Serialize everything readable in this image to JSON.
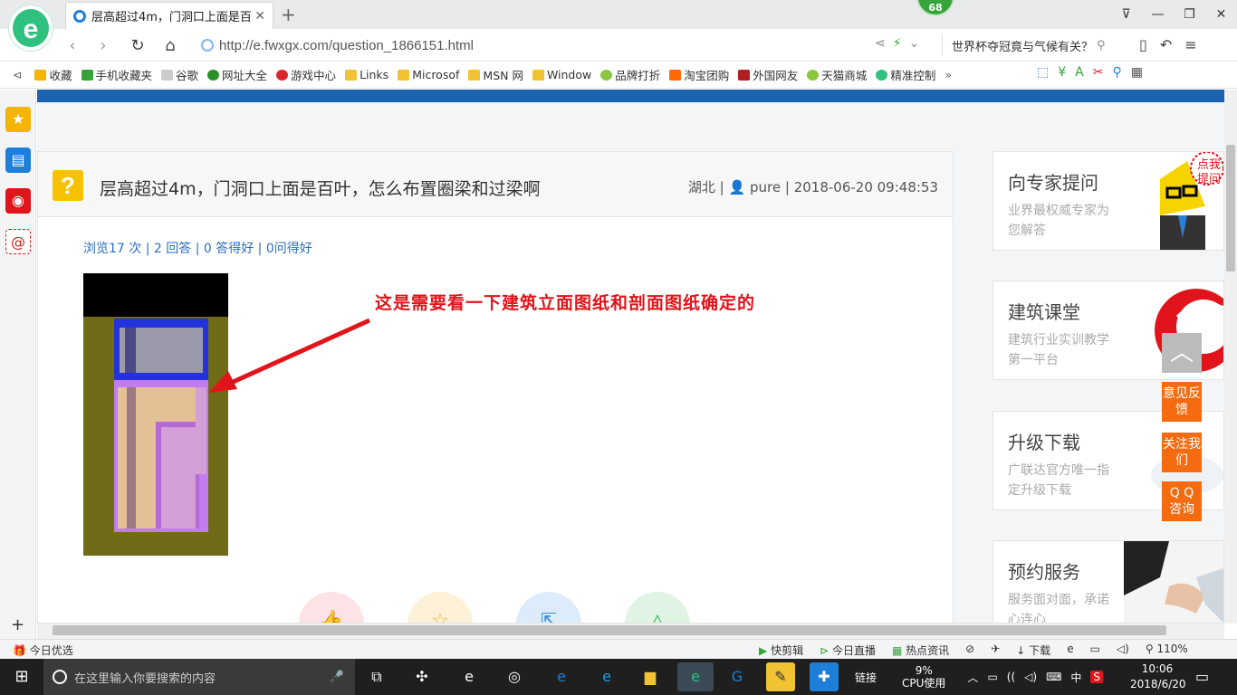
{
  "browser": {
    "tab_title": "层高超过4m，门洞口上面是百叶",
    "tab_close": "✕",
    "new_tab": "+",
    "badge_count": "68",
    "url": "http://e.fwxgx.com/question_1866151.html",
    "search_text": "世界杯夺冠竟与气候有关？",
    "window_controls": [
      "⊽",
      "—",
      "❐",
      "✕"
    ],
    "bookmarks": [
      {
        "label": "收藏",
        "color": "#f5b400"
      },
      {
        "label": "手机收藏夹",
        "color": "#37a43a"
      },
      {
        "label": "谷歌",
        "color": "#cccccc"
      },
      {
        "label": "网址大全",
        "color": "#2a8f2a"
      },
      {
        "label": "游戏中心",
        "color": "#d9262b"
      },
      {
        "label": "Links",
        "color": "#f1c232"
      },
      {
        "label": "Microsof",
        "color": "#f1c232"
      },
      {
        "label": "MSN 网",
        "color": "#f1c232"
      },
      {
        "label": "Window",
        "color": "#f1c232"
      },
      {
        "label": "品牌打折",
        "color": "#8cc63f"
      },
      {
        "label": "淘宝团购",
        "color": "#ff6a00"
      },
      {
        "label": "外国网友",
        "color": "#b01e23"
      },
      {
        "label": "天猫商城",
        "color": "#8cc63f"
      },
      {
        "label": "精准控制",
        "color": "#2ec27e"
      }
    ],
    "more": "»"
  },
  "question": {
    "title": "层高超过4m，门洞口上面是百叶，怎么布置圈梁和过梁啊",
    "location": "湖北",
    "user": "pure",
    "datetime": "2018-06-20 09:48:53",
    "views": "浏览17 次",
    "answers": "2 回答",
    "good_answers": "0 答得好",
    "good_questions": "0问得好",
    "annotation": "这是需要看一下建筑立面图纸和剖面图纸确定的"
  },
  "sidebar_cards": [
    {
      "title": "向专家提问",
      "subtitle": "业界最权威专家为您解答",
      "bubble": "点我提问"
    },
    {
      "title": "建筑课堂",
      "subtitle": "建筑行业实训教学第一平台"
    },
    {
      "title": "升级下载",
      "subtitle": "广联达官方唯一指定升级下载"
    },
    {
      "title": "预约服务",
      "subtitle": "服务面对面，承诺心连心"
    }
  ],
  "float_buttons": {
    "feedback": "意见反馈",
    "follow": "关注我们",
    "qq": "Q Q 咨询"
  },
  "statusbar": {
    "left": "今日优选",
    "items": [
      "快剪辑",
      "今日直播",
      "热点资讯",
      "下载",
      "110%"
    ]
  },
  "taskbar": {
    "search_placeholder": "在这里输入你要搜索的内容",
    "links": "链接",
    "cpu": "9%",
    "cpu_label": "CPU使用",
    "ime": "中",
    "time": "10:06",
    "date": "2018/6/20"
  }
}
